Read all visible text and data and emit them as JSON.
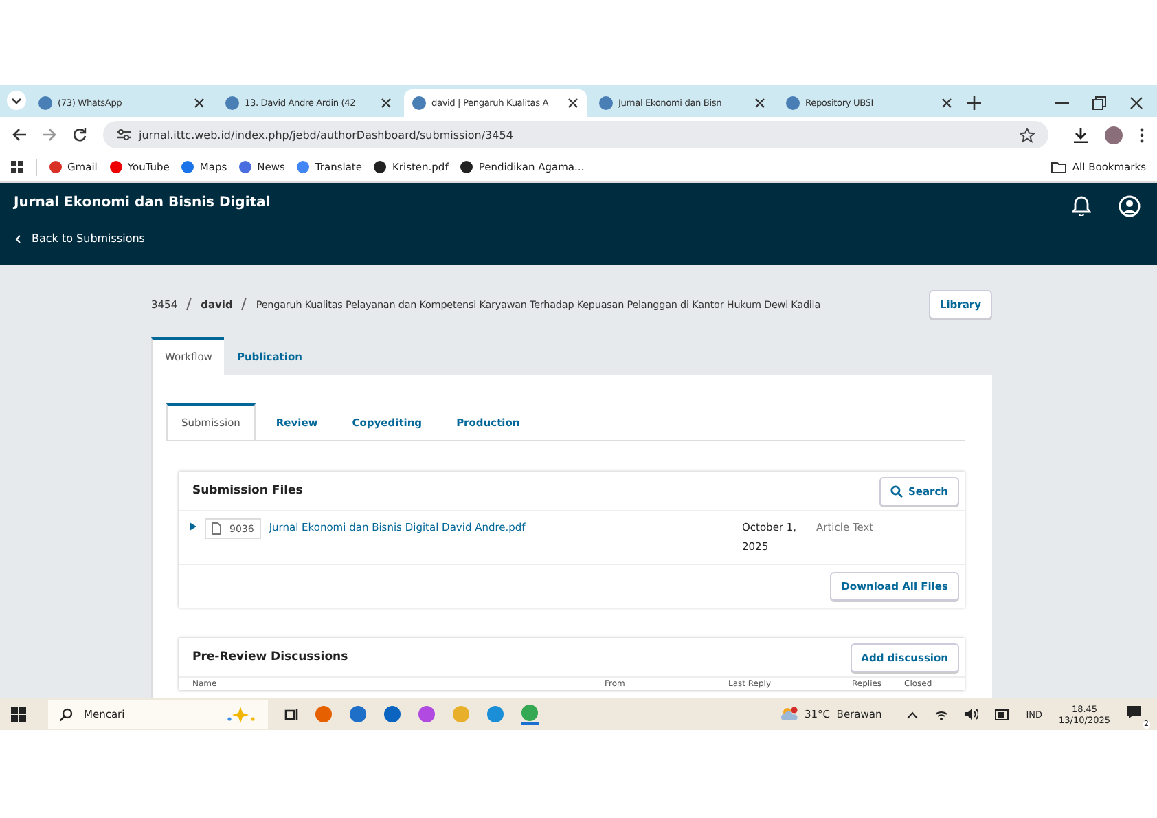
{
  "browser": {
    "tabs": [
      {
        "title": "(73) WhatsApp",
        "selected": false
      },
      {
        "title": "13. David Andre Ardin (42",
        "selected": false
      },
      {
        "title": "david | Pengaruh Kualitas A",
        "selected": true
      },
      {
        "title": "Jurnal Ekonomi dan Bisn",
        "selected": false
      },
      {
        "title": "Repository UBSI",
        "selected": false
      }
    ],
    "url": "jurnal.ittc.web.id/index.php/jebd/authorDashboard/submission/3454",
    "bookmarks": [
      "Gmail",
      "YouTube",
      "Maps",
      "News",
      "Translate",
      "Kristen.pdf",
      "Pendidikan Agama..."
    ],
    "all_bookmarks": "All Bookmarks"
  },
  "app": {
    "journal_title": "Jurnal Ekonomi dan Bisnis Digital",
    "back_link": "Back to Submissions",
    "breadcrumb": {
      "id": "3454",
      "author": "david",
      "title": "Pengaruh Kualitas Pelayanan dan Kompetensi Karyawan Terhadap Kepuasan Pelanggan di Kantor Hukum Dewi Kadila"
    },
    "library_button": "Library",
    "tabs": [
      {
        "label": "Workflow",
        "selected": true
      },
      {
        "label": "Publication",
        "selected": false
      }
    ],
    "stage_tabs": [
      {
        "label": "Submission",
        "selected": true
      },
      {
        "label": "Review",
        "selected": false
      },
      {
        "label": "Copyediting",
        "selected": false
      },
      {
        "label": "Production",
        "selected": false
      }
    ],
    "files_panel": {
      "title": "Submission Files",
      "search_button": "Search",
      "files": [
        {
          "id": "9036",
          "name": "Jurnal Ekonomi dan Bisnis Digital David Andre.pdf",
          "date": "October 1, 2025",
          "type": "Article Text"
        }
      ],
      "download_button": "Download All Files"
    },
    "discussions_panel": {
      "title": "Pre-Review Discussions",
      "add_button": "Add discussion",
      "columns": [
        "Name",
        "From",
        "Last Reply",
        "Replies",
        "Closed"
      ]
    }
  },
  "taskbar": {
    "search_placeholder": "Mencari",
    "weather": "31°C  Berawan",
    "language": "IND",
    "time": "18.45",
    "date": "13/10/2025",
    "notifications": "2"
  }
}
